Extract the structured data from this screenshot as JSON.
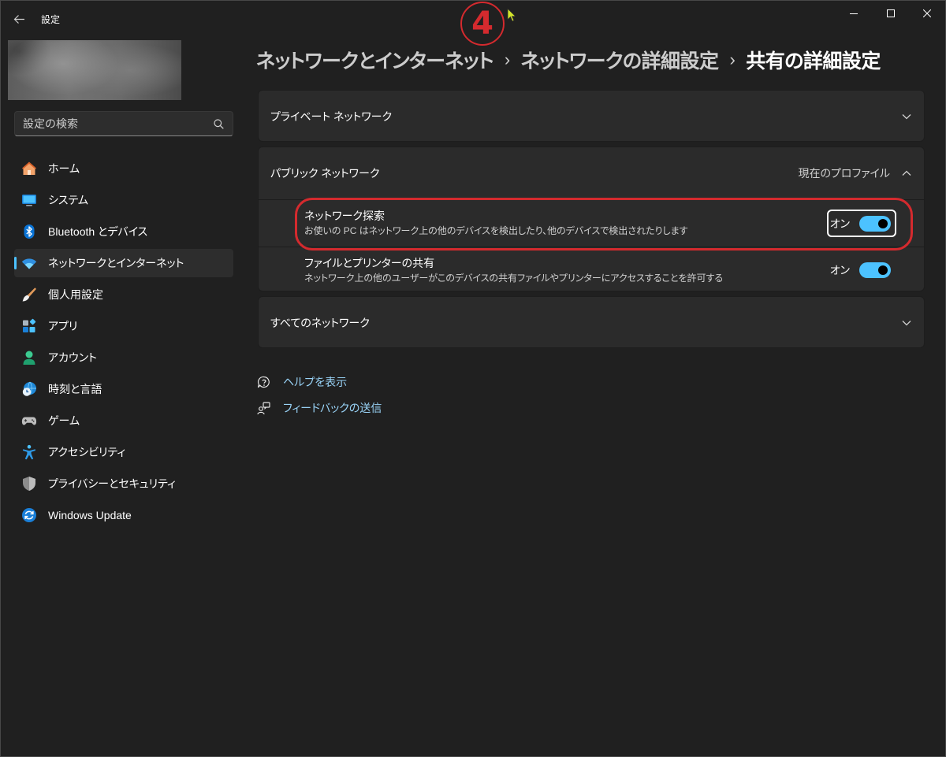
{
  "window": {
    "title": "設定",
    "back_icon": "back-arrow-icon",
    "controls": [
      "minimize-icon",
      "maximize-icon",
      "close-icon"
    ]
  },
  "annotation": {
    "step_number": "4",
    "color": "#d42a2e"
  },
  "search": {
    "placeholder": "設定の検索",
    "icon": "search-icon"
  },
  "sidebar": {
    "items": [
      {
        "label": "ホーム",
        "icon": "home-icon",
        "selected": false
      },
      {
        "label": "システム",
        "icon": "monitor-icon",
        "selected": false
      },
      {
        "label": "Bluetooth とデバイス",
        "icon": "bluetooth-icon",
        "selected": false
      },
      {
        "label": "ネットワークとインターネット",
        "icon": "wifi-icon",
        "selected": true
      },
      {
        "label": "個人用設定",
        "icon": "paintbrush-icon",
        "selected": false
      },
      {
        "label": "アプリ",
        "icon": "apps-icon",
        "selected": false
      },
      {
        "label": "アカウント",
        "icon": "account-icon",
        "selected": false
      },
      {
        "label": "時刻と言語",
        "icon": "globe-clock-icon",
        "selected": false
      },
      {
        "label": "ゲーム",
        "icon": "game-controller-icon",
        "selected": false
      },
      {
        "label": "アクセシビリティ",
        "icon": "accessibility-icon",
        "selected": false
      },
      {
        "label": "プライバシーとセキュリティ",
        "icon": "shield-icon",
        "selected": false
      },
      {
        "label": "Windows Update",
        "icon": "windows-update-icon",
        "selected": false
      }
    ]
  },
  "breadcrumb": {
    "separator": "›",
    "items": [
      "ネットワークとインターネット",
      "ネットワークの詳細設定",
      "共有の詳細設定"
    ]
  },
  "sections": [
    {
      "label": "プライベート ネットワーク",
      "expanded": false,
      "icon": "chevron-down-icon"
    },
    {
      "label": "パブリック ネットワーク",
      "expanded": true,
      "icon": "chevron-up-icon",
      "status": "現在のプロファイル",
      "settings": [
        {
          "title": "ネットワーク探索",
          "description": "お使いの PC はネットワーク上の他のデバイスを検出したり、他のデバイスで検出されたりします",
          "state_label": "オン",
          "on": true,
          "focused": true,
          "highlighted": true
        },
        {
          "title": "ファイルとプリンターの共有",
          "description": "ネットワーク上の他のユーザーがこのデバイスの共有ファイルやプリンターにアクセスすることを許可する",
          "state_label": "オン",
          "on": true
        }
      ]
    },
    {
      "label": "すべてのネットワーク",
      "expanded": false,
      "icon": "chevron-down-icon"
    }
  ],
  "links": [
    {
      "label": "ヘルプを表示",
      "icon": "help-icon"
    },
    {
      "label": "フィードバックの送信",
      "icon": "feedback-icon"
    }
  ],
  "colors": {
    "background": "#202020",
    "card": "#2b2b2b",
    "accent": "#4cc2ff",
    "link": "#99d3f7",
    "annotation_red": "#d42a2e",
    "cursor": "#d4e62a"
  }
}
